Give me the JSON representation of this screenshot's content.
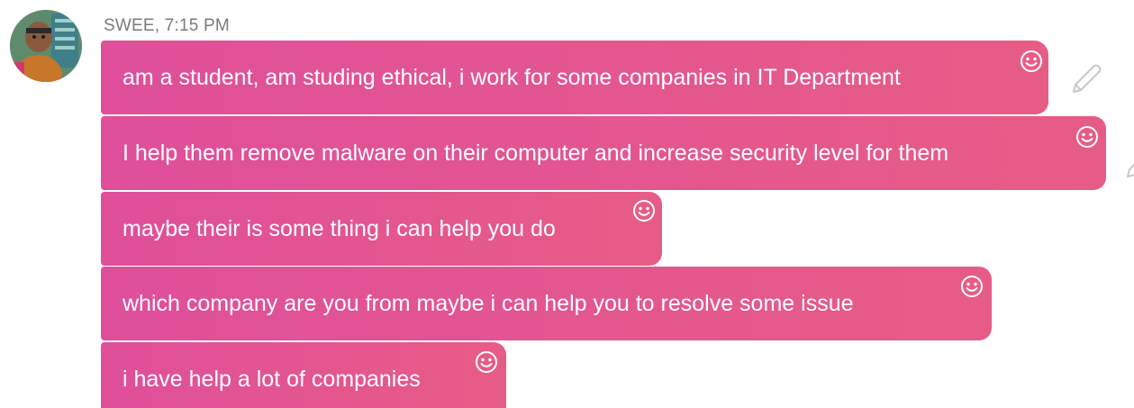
{
  "sender": {
    "name_time": "SWEE, 7:15 PM"
  },
  "messages": [
    {
      "text": "am a student, am studing ethical, i work for some companies in IT Department"
    },
    {
      "text": "I help them remove malware on their computer and increase security level for them"
    },
    {
      "text": "maybe their is some thing i can help you do"
    },
    {
      "text": "which company are you from maybe i can help you to resolve some issue"
    },
    {
      "text": "i have help a lot of companies"
    }
  ],
  "icons": {
    "reaction": "smiley-icon",
    "edit": "pencil-icon"
  },
  "colors": {
    "bubble_start": "#df4f9b",
    "bubble_end": "#e75c86",
    "meta_text": "#7a7a7a",
    "bubble_text": "#ffffff"
  }
}
